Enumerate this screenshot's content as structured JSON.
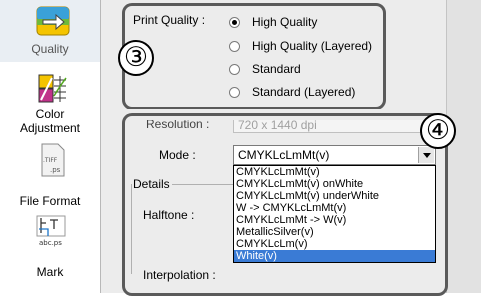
{
  "sidebar": {
    "items": [
      {
        "label": "Quality",
        "icon": "quality-icon"
      },
      {
        "label": "Color\nAdjustment",
        "icon": "color-adjustment-icon"
      },
      {
        "label": "File Format",
        "icon": "file-format-icon"
      },
      {
        "label": "Mark",
        "icon": "mark-icon"
      }
    ],
    "file_icon_ext": ".TIFF",
    "file_icon_ext2": ".ps",
    "mark_icon_text": "abc.ps"
  },
  "print_quality": {
    "label": "Print Quality :",
    "options": [
      "High Quality",
      "High Quality (Layered)",
      "Standard",
      "Standard (Layered)"
    ],
    "selected": "High Quality"
  },
  "callouts": {
    "three": "③",
    "four": "④"
  },
  "resolution": {
    "label": "Resolution :",
    "value": "720 x 1440 dpi"
  },
  "mode": {
    "label": "Mode :",
    "value": "CMYKLcLmMt(v)",
    "options": [
      "CMYKLcLmMt(v)",
      "CMYKLcLmMt(v) onWhite",
      "CMYKLcLmMt(v) underWhite",
      "W -> CMYKLcLmMt(v)",
      "CMYKLcLmMt -> W(v)",
      "MetallicSilver(v)",
      "CMYKLcLm(v)",
      "White(v)"
    ],
    "highlighted": "White(v)"
  },
  "details": {
    "label": "Details"
  },
  "halftone": {
    "label": "Halftone :"
  },
  "interpolation": {
    "label": "Interpolation :"
  }
}
